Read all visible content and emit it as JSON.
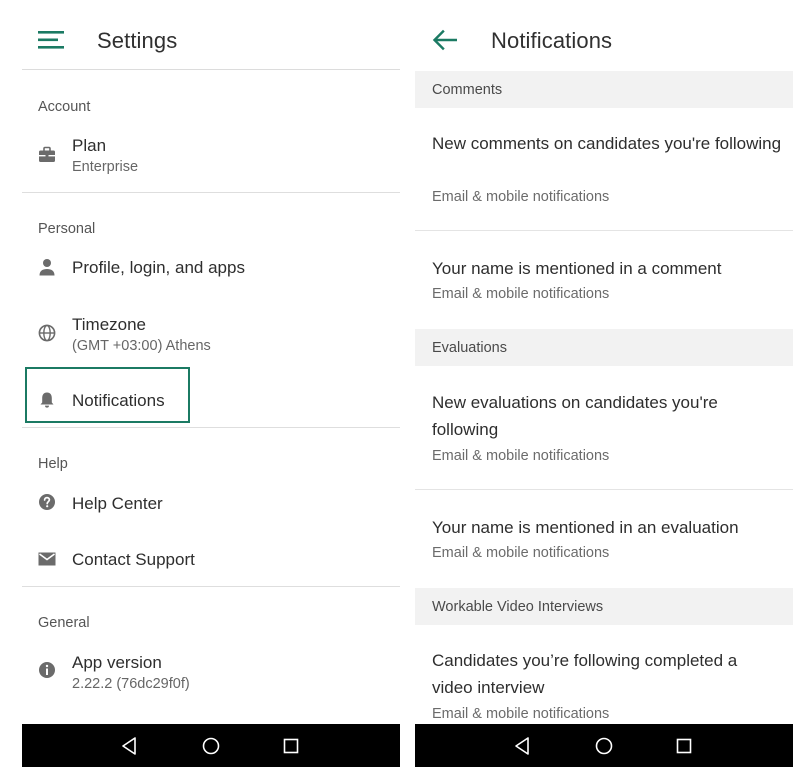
{
  "settings": {
    "title": "Settings",
    "sections": {
      "account": "Account",
      "personal": "Personal",
      "help": "Help",
      "general": "General"
    },
    "items": {
      "plan": {
        "label": "Plan",
        "sub": "Enterprise",
        "icon": "briefcase-icon"
      },
      "profile": {
        "label": "Profile, login, and apps",
        "icon": "person-icon"
      },
      "timezone": {
        "label": "Timezone",
        "sub": "(GMT +03:00) Athens",
        "icon": "globe-icon"
      },
      "notifications": {
        "label": "Notifications",
        "icon": "bell-icon"
      },
      "help_center": {
        "label": "Help Center",
        "icon": "question-icon"
      },
      "contact": {
        "label": "Contact Support",
        "icon": "mail-icon"
      },
      "version": {
        "label": "App version",
        "sub": "2.22.2 (76dc29f0f)",
        "icon": "info-icon"
      }
    }
  },
  "notifications": {
    "title": "Notifications",
    "sections": {
      "comments": "Comments",
      "evaluations": "Evaluations",
      "video": "Workable Video Interviews"
    },
    "items": [
      {
        "title": "New comments on candidates you're following",
        "sub": "Email & mobile notifications"
      },
      {
        "title": "Your name is mentioned in a comment",
        "sub": "Email & mobile notifications"
      },
      {
        "title": "New evaluations on candidates you're following",
        "sub": "Email & mobile notifications"
      },
      {
        "title": "Your name is mentioned in an evaluation",
        "sub": "Email & mobile notifications"
      },
      {
        "title": "Candidates you’re following completed a video interview",
        "sub": "Email & mobile notifications"
      }
    ]
  },
  "colors": {
    "accent": "#1b7a63",
    "icon_gray": "#6b6b6b",
    "band": "#f2f2f2",
    "navbar": "#000000"
  },
  "navbar_icons": [
    "back-triangle-icon",
    "home-circle-icon",
    "recents-square-icon"
  ]
}
